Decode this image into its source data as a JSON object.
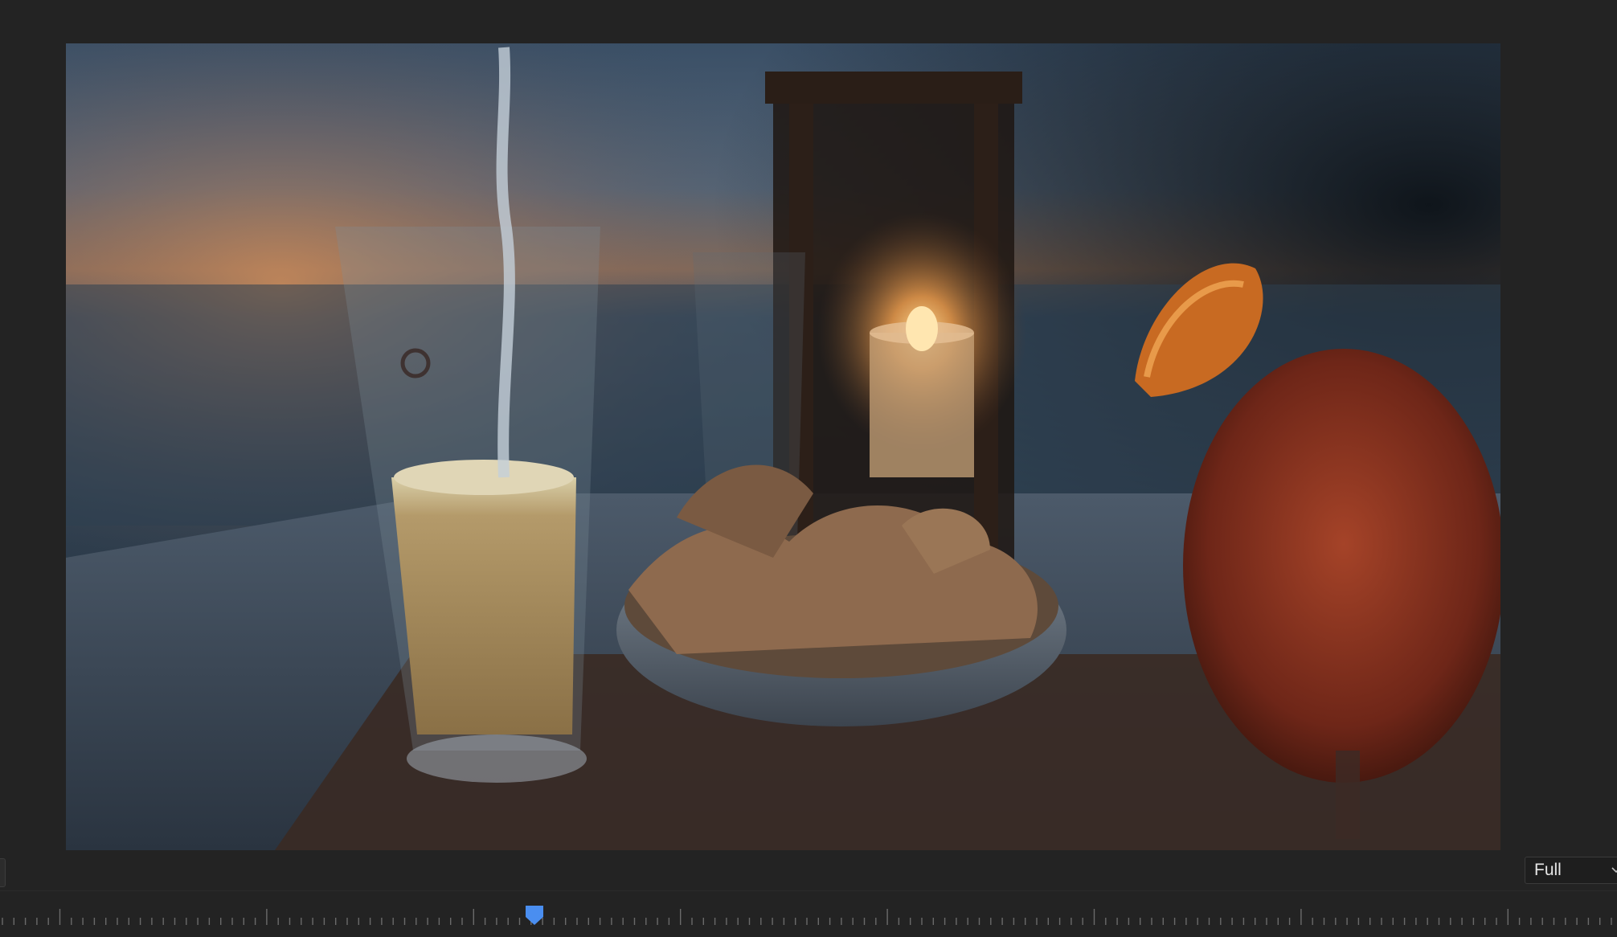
{
  "program_monitor": {
    "frame_description": "",
    "zoom": {
      "value": "Full",
      "icon": "chevron-down-icon"
    },
    "playhead": {
      "position_fraction": 0.333,
      "color": "#4a8ef0"
    }
  },
  "colors": {
    "panel_bg": "#232323",
    "tick_color": "#6a6a6a",
    "accent": "#4a8ef0"
  }
}
